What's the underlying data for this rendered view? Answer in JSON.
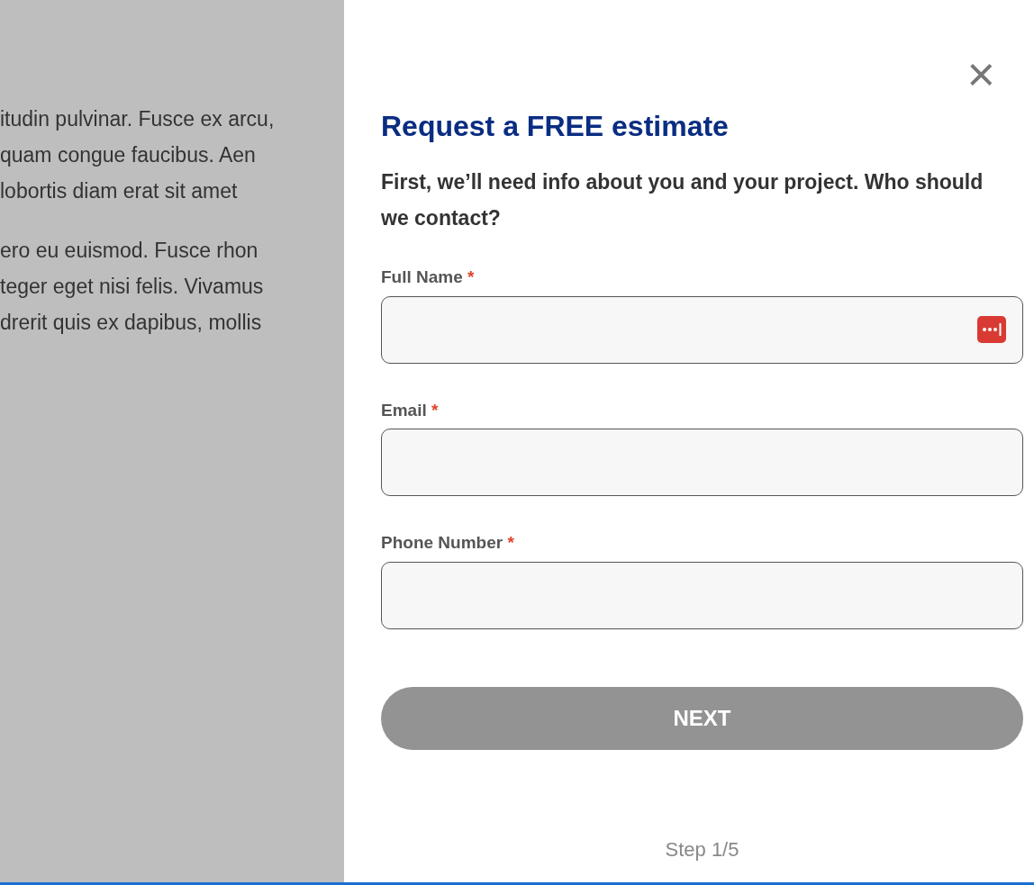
{
  "background_text": {
    "paragraphs": [
      [
        "itudin pulvinar. Fusce ex arcu,",
        "quam congue faucibus. Aen",
        "lobortis diam erat sit amet"
      ],
      [
        "ero eu euismod. Fusce rhon",
        "teger eget nisi felis. Vivamus",
        "drerit quis ex dapibus, mollis"
      ]
    ]
  },
  "panel": {
    "close": "×",
    "title": "Request a FREE estimate",
    "subtitle": "First, we’ll need info about you and your project. Who should we contact?",
    "fields": [
      {
        "label": "Full Name",
        "required_mark": "*"
      },
      {
        "label": "Email",
        "required_mark": "*"
      },
      {
        "label": "Phone Number",
        "required_mark": "*"
      }
    ],
    "button": {
      "label": "NEXT",
      "disabled": true
    },
    "step": "Step 1/5"
  }
}
